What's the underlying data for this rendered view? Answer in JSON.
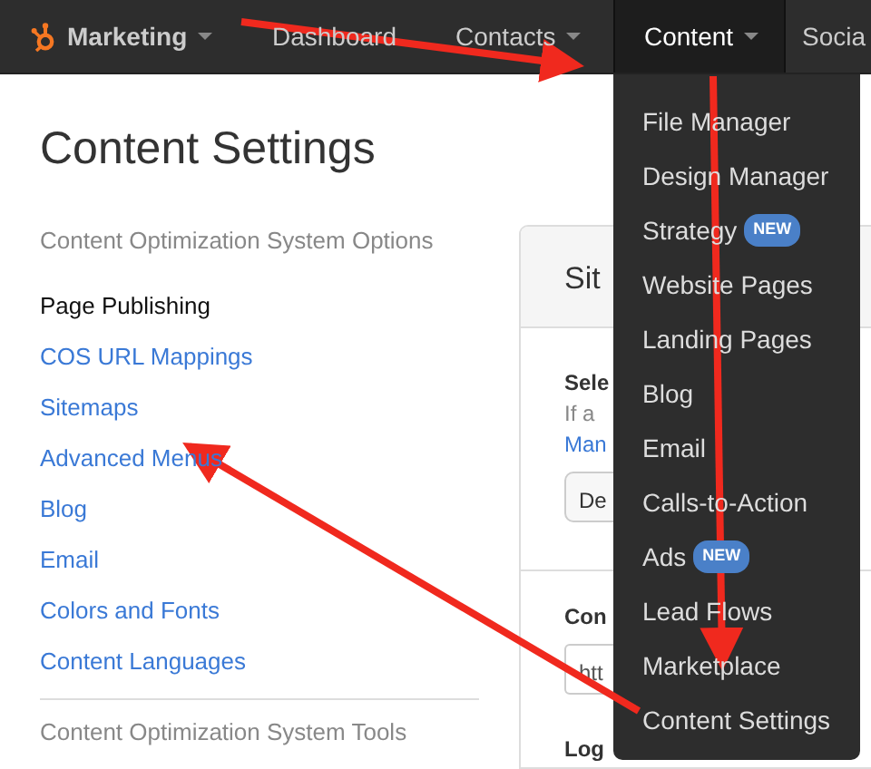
{
  "navbar": {
    "brand": {
      "label": "Marketing",
      "caret": true
    },
    "items": [
      {
        "label": "Dashboard",
        "caret": false,
        "selected": false,
        "expanded": false
      },
      {
        "label": "Contacts",
        "caret": true,
        "selected": false,
        "expanded": false
      },
      {
        "label": "Content",
        "caret": true,
        "selected": true,
        "expanded": true,
        "menu": [
          {
            "label": "File Manager"
          },
          {
            "label": "Design Manager"
          },
          {
            "label": "Strategy",
            "badge": "NEW"
          },
          {
            "label": "Website Pages"
          },
          {
            "label": "Landing Pages"
          },
          {
            "label": "Blog"
          },
          {
            "label": "Email"
          },
          {
            "label": "Calls-to-Action"
          },
          {
            "label": "Ads",
            "badge": "NEW"
          },
          {
            "label": "Lead Flows"
          },
          {
            "label": "Marketplace"
          },
          {
            "label": "Content Settings"
          }
        ]
      },
      {
        "label": "Socia",
        "caret": false,
        "selected": false,
        "expanded": false
      }
    ]
  },
  "page_title": "Content Settings",
  "sidebar": {
    "heading": "Content Optimization System Options",
    "items": [
      {
        "label": "Page Publishing",
        "selected": true
      },
      {
        "label": "COS URL Mappings",
        "selected": false
      },
      {
        "label": "Sitemaps",
        "selected": false
      },
      {
        "label": "Advanced Menus",
        "selected": false
      },
      {
        "label": "Blog",
        "selected": false
      },
      {
        "label": "Email",
        "selected": false
      },
      {
        "label": "Colors and Fonts",
        "selected": false
      },
      {
        "label": "Content Languages",
        "selected": false
      }
    ],
    "footer_heading": "Content Optimization System Tools"
  },
  "panel": {
    "title": "Sit",
    "fields": [
      {
        "kind": "select",
        "label": "Sele",
        "help": "If a",
        "link": "Man",
        "value": "De"
      },
      {
        "kind": "input",
        "label": "Con",
        "value": "htt"
      },
      {
        "kind": "heading",
        "label": "Log"
      }
    ]
  }
}
